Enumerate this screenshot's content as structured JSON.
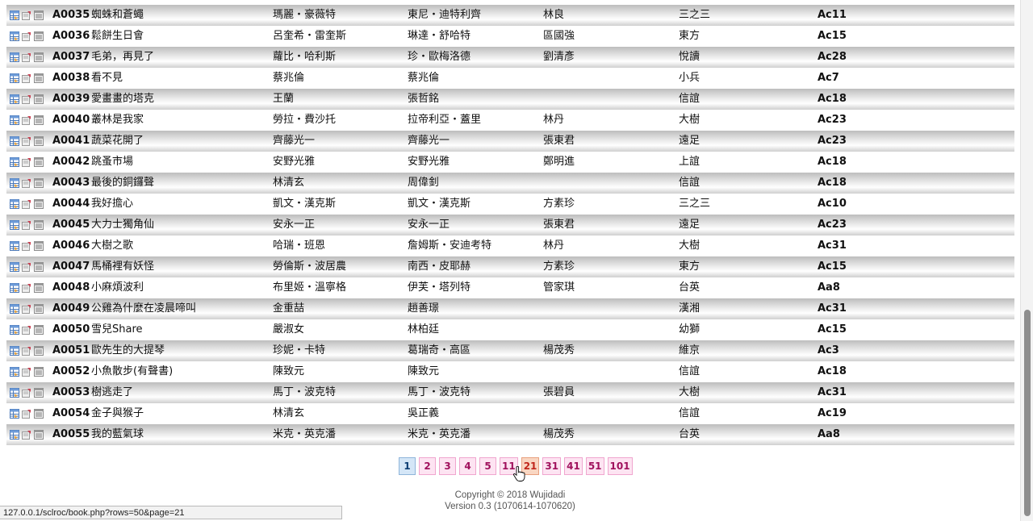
{
  "rows": [
    {
      "id": "A0035",
      "title": "蜘蛛和蒼蠅",
      "author": "瑪麗・豪薇特",
      "illustrator": "東尼・迪特利齊",
      "translator": "林良",
      "publisher": "三之三",
      "code": "Ac11"
    },
    {
      "id": "A0036",
      "title": "鬆餅生日會",
      "author": "呂奎希・雷奎斯",
      "illustrator": "琳達・舒哈特",
      "translator": "區國強",
      "publisher": "東方",
      "code": "Ac15"
    },
    {
      "id": "A0037",
      "title": "毛弟，再見了",
      "author": "蘿比・哈利斯",
      "illustrator": "珍・歐梅洛德",
      "translator": "劉清彥",
      "publisher": "悅讀",
      "code": "Ac28"
    },
    {
      "id": "A0038",
      "title": "看不見",
      "author": "蔡兆倫",
      "illustrator": "蔡兆倫",
      "translator": "",
      "publisher": "小兵",
      "code": "Ac7"
    },
    {
      "id": "A0039",
      "title": "愛畫畫的塔克",
      "author": "王蘭",
      "illustrator": "張哲銘",
      "translator": "",
      "publisher": "信誼",
      "code": "Ac18"
    },
    {
      "id": "A0040",
      "title": "叢林是我家",
      "author": "勞拉・費沙托",
      "illustrator": "拉帝利亞・蓋里",
      "translator": "林丹",
      "publisher": "大樹",
      "code": "Ac23"
    },
    {
      "id": "A0041",
      "title": "蔬菜花開了",
      "author": "齊藤光一",
      "illustrator": "齊藤光一",
      "translator": "張東君",
      "publisher": "遠足",
      "code": "Ac23"
    },
    {
      "id": "A0042",
      "title": "跳蚤市場",
      "author": "安野光雅",
      "illustrator": "安野光雅",
      "translator": "鄭明進",
      "publisher": "上誼",
      "code": "Ac18"
    },
    {
      "id": "A0043",
      "title": "最後的銅鑼聲",
      "author": "林清玄",
      "illustrator": "周偉釗",
      "translator": "",
      "publisher": "信誼",
      "code": "Ac18"
    },
    {
      "id": "A0044",
      "title": "我好擔心",
      "author": "凱文・漢克斯",
      "illustrator": "凱文・漢克斯",
      "translator": "方素珍",
      "publisher": "三之三",
      "code": "Ac10"
    },
    {
      "id": "A0045",
      "title": "大力士獨角仙",
      "author": "安永一正",
      "illustrator": "安永一正",
      "translator": "張東君",
      "publisher": "遠足",
      "code": "Ac23"
    },
    {
      "id": "A0046",
      "title": "大樹之歌",
      "author": "哈瑞・班恩",
      "illustrator": "詹姆斯・安迪考特",
      "translator": "林丹",
      "publisher": "大樹",
      "code": "Ac31"
    },
    {
      "id": "A0047",
      "title": "馬桶裡有妖怪",
      "author": "勞倫斯・波居農",
      "illustrator": "南西・皮耶赫",
      "translator": "方素珍",
      "publisher": "東方",
      "code": "Ac15"
    },
    {
      "id": "A0048",
      "title": "小麻煩波利",
      "author": "布里姬・溫寧格",
      "illustrator": "伊芙・塔列特",
      "translator": "管家琪",
      "publisher": "台英",
      "code": "Aa8"
    },
    {
      "id": "A0049",
      "title": "公雞為什麼在凌晨啼叫",
      "author": "金重喆",
      "illustrator": "趙善璟",
      "translator": "",
      "publisher": "漢湘",
      "code": "Ac31"
    },
    {
      "id": "A0050",
      "title": "雪兒Share",
      "author": "嚴淑女",
      "illustrator": "林柏廷",
      "translator": "",
      "publisher": "幼獅",
      "code": "Ac15"
    },
    {
      "id": "A0051",
      "title": "歐先生的大提琴",
      "author": "珍妮・卡特",
      "illustrator": "葛瑞奇・高區",
      "translator": "楊茂秀",
      "publisher": "維京",
      "code": "Ac3"
    },
    {
      "id": "A0052",
      "title": "小魚散步(有聲書)",
      "author": "陳致元",
      "illustrator": "陳致元",
      "translator": "",
      "publisher": "信誼",
      "code": "Ac18"
    },
    {
      "id": "A0053",
      "title": "樹逃走了",
      "author": "馬丁・波克特",
      "illustrator": "馬丁・波克特",
      "translator": "張碧員",
      "publisher": "大樹",
      "code": "Ac31"
    },
    {
      "id": "A0054",
      "title": "金子與猴子",
      "author": "林清玄",
      "illustrator": "吳正義",
      "translator": "",
      "publisher": "信誼",
      "code": "Ac19"
    },
    {
      "id": "A0055",
      "title": "我的藍氣球",
      "author": "米克・英克潘",
      "illustrator": "米克・英克潘",
      "translator": "楊茂秀",
      "publisher": "台英",
      "code": "Aa8"
    }
  ],
  "row_icons": [
    "table-view-icon",
    "edit-icon",
    "list-icon"
  ],
  "pagination": {
    "pages": [
      "1",
      "2",
      "3",
      "4",
      "5",
      "11",
      "21",
      "31",
      "41",
      "51",
      "101"
    ],
    "current": "1",
    "hover": "21"
  },
  "footer": {
    "copyright": "Copyright © 2018 Wujidadi",
    "version": "Version 0.3 (1070614-1070620)"
  },
  "status_url": "127.0.0.1/sclroc/book.php?rows=50&page=21",
  "colors": {
    "pager_bg": "#fde4f2",
    "pager_text": "#a0115d",
    "pager_current_bg": "#d4e6f7",
    "pager_hover_text": "#c0251b"
  }
}
